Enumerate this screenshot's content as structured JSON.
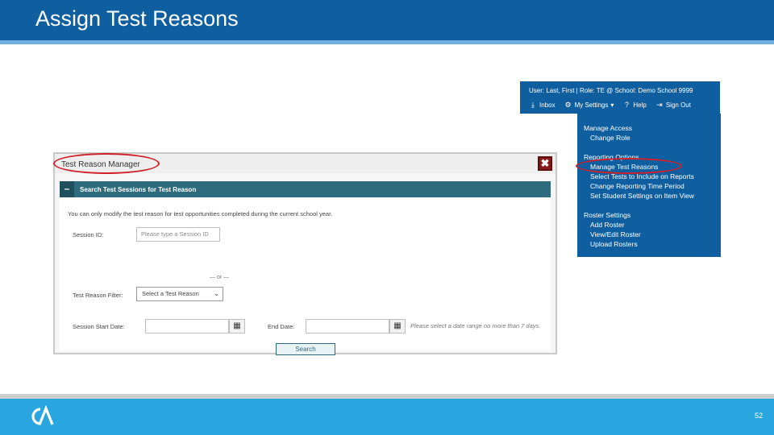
{
  "slide": {
    "title": "Assign Test Reasons",
    "page_number": "52"
  },
  "user_bar": {
    "user_line": "User: Last, First  |  Role: TE @ School: Demo School 9999",
    "inbox_label": "Inbox",
    "settings_label": "My Settings",
    "help_label": "Help",
    "signout_label": "Sign Out"
  },
  "settings_menu": {
    "groups": [
      {
        "heading": "Manage Access",
        "items": [
          "Change Role"
        ]
      },
      {
        "heading": "Reporting Options",
        "items": [
          "Manage Test Reasons",
          "Select Tests to Include on Reports",
          "Change Reporting Time Period",
          "Set Student Settings on Item View"
        ]
      },
      {
        "heading": "Roster Settings",
        "items": [
          "Add Roster",
          "View/Edit Roster",
          "Upload Rosters"
        ]
      }
    ]
  },
  "modal": {
    "title": "Test Reason Manager",
    "close_label": "✖",
    "section_title": "Search Test Sessions for Test Reason",
    "intro": "You can only modify the test reason for test opportunities completed during the current school year.",
    "session_id_label": "Session ID:",
    "session_id_placeholder": "Please type a Session ID",
    "or_text": "— or —",
    "reason_filter_label": "Test Reason Filter:",
    "reason_filter_value": "Select a Test Reason",
    "start_date_label": "Session Start Date:",
    "end_date_label": "End Date:",
    "date_hint": "Please select a date range no more than 7 days.",
    "search_label": "Search"
  },
  "colors": {
    "brand_blue": "#0f5fa0",
    "footer_blue": "#29a6df",
    "section_teal": "#2e6b7c",
    "highlight_red": "#d0202a"
  }
}
